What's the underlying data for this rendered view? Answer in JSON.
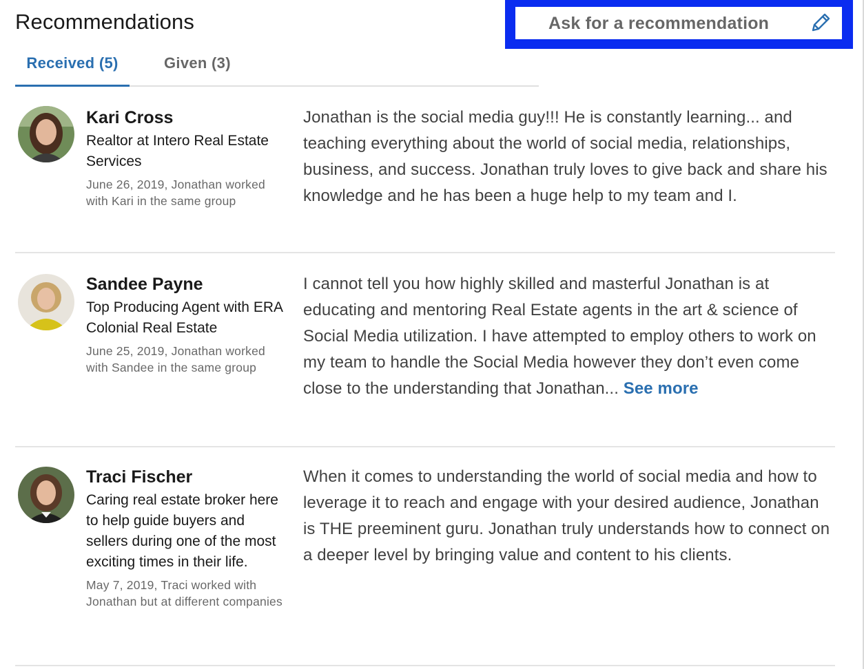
{
  "section": {
    "title": "Recommendations",
    "ask_button_label": "Ask for a recommendation",
    "ask_icon": "pencil-icon",
    "highlight_color": "#0a2cf0",
    "accent_color": "#2a6fb0"
  },
  "tabs": [
    {
      "label": "Received (5)",
      "active": true
    },
    {
      "label": "Given (3)",
      "active": false
    }
  ],
  "recommendations": [
    {
      "name": "Kari Cross",
      "headline": "Realtor at Intero Real Estate Services",
      "relation": "June 26, 2019, Jonathan worked with Kari in the same group",
      "text": "Jonathan is the social media guy!!! He is constantly learning... and teaching everything about the world of social media, relationships, business, and success. Jonathan truly loves to give back and share his knowledge and he has been a huge help to my team and I.",
      "see_more": ""
    },
    {
      "name": "Sandee Payne",
      "headline": "Top Producing Agent with ERA Colonial Real Estate",
      "relation": "June 25, 2019, Jonathan worked with Sandee in the same group",
      "text": "I cannot tell you how highly skilled and masterful Jonathan is at educating and mentoring Real Estate agents in the art & science of Social Media utilization. I have attempted to employ others to work on my team to handle the Social Media however they don’t even come close to the understanding that Jonathan...",
      "see_more": "See more"
    },
    {
      "name": "Traci Fischer",
      "headline": "Caring real estate broker here to help guide buyers and sellers during one of the most exciting times in their life.",
      "relation": "May 7, 2019, Traci worked with Jonathan but at different companies",
      "text": "When it comes to understanding the world of social media and how to leverage it to reach and engage with your desired audience, Jonathan is THE preeminent guru. Jonathan truly understands how to connect on a deeper level by bringing value and content to his clients.",
      "see_more": ""
    }
  ]
}
